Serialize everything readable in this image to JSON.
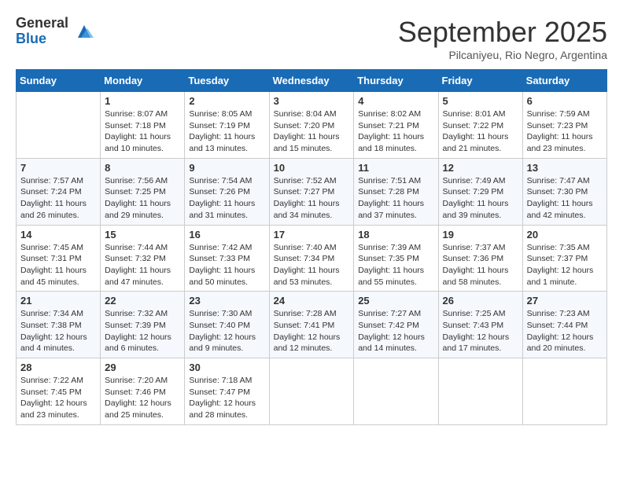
{
  "header": {
    "logo_general": "General",
    "logo_blue": "Blue",
    "month_title": "September 2025",
    "subtitle": "Pilcaniyeu, Rio Negro, Argentina"
  },
  "days_of_week": [
    "Sunday",
    "Monday",
    "Tuesday",
    "Wednesday",
    "Thursday",
    "Friday",
    "Saturday"
  ],
  "weeks": [
    [
      {
        "day": "",
        "content": ""
      },
      {
        "day": "1",
        "content": "Sunrise: 8:07 AM\nSunset: 7:18 PM\nDaylight: 11 hours\nand 10 minutes."
      },
      {
        "day": "2",
        "content": "Sunrise: 8:05 AM\nSunset: 7:19 PM\nDaylight: 11 hours\nand 13 minutes."
      },
      {
        "day": "3",
        "content": "Sunrise: 8:04 AM\nSunset: 7:20 PM\nDaylight: 11 hours\nand 15 minutes."
      },
      {
        "day": "4",
        "content": "Sunrise: 8:02 AM\nSunset: 7:21 PM\nDaylight: 11 hours\nand 18 minutes."
      },
      {
        "day": "5",
        "content": "Sunrise: 8:01 AM\nSunset: 7:22 PM\nDaylight: 11 hours\nand 21 minutes."
      },
      {
        "day": "6",
        "content": "Sunrise: 7:59 AM\nSunset: 7:23 PM\nDaylight: 11 hours\nand 23 minutes."
      }
    ],
    [
      {
        "day": "7",
        "content": "Sunrise: 7:57 AM\nSunset: 7:24 PM\nDaylight: 11 hours\nand 26 minutes."
      },
      {
        "day": "8",
        "content": "Sunrise: 7:56 AM\nSunset: 7:25 PM\nDaylight: 11 hours\nand 29 minutes."
      },
      {
        "day": "9",
        "content": "Sunrise: 7:54 AM\nSunset: 7:26 PM\nDaylight: 11 hours\nand 31 minutes."
      },
      {
        "day": "10",
        "content": "Sunrise: 7:52 AM\nSunset: 7:27 PM\nDaylight: 11 hours\nand 34 minutes."
      },
      {
        "day": "11",
        "content": "Sunrise: 7:51 AM\nSunset: 7:28 PM\nDaylight: 11 hours\nand 37 minutes."
      },
      {
        "day": "12",
        "content": "Sunrise: 7:49 AM\nSunset: 7:29 PM\nDaylight: 11 hours\nand 39 minutes."
      },
      {
        "day": "13",
        "content": "Sunrise: 7:47 AM\nSunset: 7:30 PM\nDaylight: 11 hours\nand 42 minutes."
      }
    ],
    [
      {
        "day": "14",
        "content": "Sunrise: 7:45 AM\nSunset: 7:31 PM\nDaylight: 11 hours\nand 45 minutes."
      },
      {
        "day": "15",
        "content": "Sunrise: 7:44 AM\nSunset: 7:32 PM\nDaylight: 11 hours\nand 47 minutes."
      },
      {
        "day": "16",
        "content": "Sunrise: 7:42 AM\nSunset: 7:33 PM\nDaylight: 11 hours\nand 50 minutes."
      },
      {
        "day": "17",
        "content": "Sunrise: 7:40 AM\nSunset: 7:34 PM\nDaylight: 11 hours\nand 53 minutes."
      },
      {
        "day": "18",
        "content": "Sunrise: 7:39 AM\nSunset: 7:35 PM\nDaylight: 11 hours\nand 55 minutes."
      },
      {
        "day": "19",
        "content": "Sunrise: 7:37 AM\nSunset: 7:36 PM\nDaylight: 11 hours\nand 58 minutes."
      },
      {
        "day": "20",
        "content": "Sunrise: 7:35 AM\nSunset: 7:37 PM\nDaylight: 12 hours\nand 1 minute."
      }
    ],
    [
      {
        "day": "21",
        "content": "Sunrise: 7:34 AM\nSunset: 7:38 PM\nDaylight: 12 hours\nand 4 minutes."
      },
      {
        "day": "22",
        "content": "Sunrise: 7:32 AM\nSunset: 7:39 PM\nDaylight: 12 hours\nand 6 minutes."
      },
      {
        "day": "23",
        "content": "Sunrise: 7:30 AM\nSunset: 7:40 PM\nDaylight: 12 hours\nand 9 minutes."
      },
      {
        "day": "24",
        "content": "Sunrise: 7:28 AM\nSunset: 7:41 PM\nDaylight: 12 hours\nand 12 minutes."
      },
      {
        "day": "25",
        "content": "Sunrise: 7:27 AM\nSunset: 7:42 PM\nDaylight: 12 hours\nand 14 minutes."
      },
      {
        "day": "26",
        "content": "Sunrise: 7:25 AM\nSunset: 7:43 PM\nDaylight: 12 hours\nand 17 minutes."
      },
      {
        "day": "27",
        "content": "Sunrise: 7:23 AM\nSunset: 7:44 PM\nDaylight: 12 hours\nand 20 minutes."
      }
    ],
    [
      {
        "day": "28",
        "content": "Sunrise: 7:22 AM\nSunset: 7:45 PM\nDaylight: 12 hours\nand 23 minutes."
      },
      {
        "day": "29",
        "content": "Sunrise: 7:20 AM\nSunset: 7:46 PM\nDaylight: 12 hours\nand 25 minutes."
      },
      {
        "day": "30",
        "content": "Sunrise: 7:18 AM\nSunset: 7:47 PM\nDaylight: 12 hours\nand 28 minutes."
      },
      {
        "day": "",
        "content": ""
      },
      {
        "day": "",
        "content": ""
      },
      {
        "day": "",
        "content": ""
      },
      {
        "day": "",
        "content": ""
      }
    ]
  ]
}
